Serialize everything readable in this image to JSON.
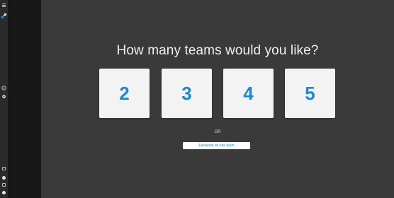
{
  "screen": {
    "question": "How many teams would you like?",
    "choices": [
      {
        "label": "2"
      },
      {
        "label": "3"
      },
      {
        "label": "4"
      },
      {
        "label": "5"
      }
    ],
    "or_label": "OR",
    "one_team_label": "Everyone on one team"
  },
  "colors": {
    "main_background": "#3a3a3a",
    "choice_background": "#f3f3f3",
    "choice_text": "#1e88d6",
    "sidebar": "#171717",
    "rail": "#2a2a2a"
  },
  "rail_icons": [
    "menu-icon",
    "app-logo-icon",
    "info-icon",
    "settings-icon",
    "panel-icon",
    "user-icon",
    "chat-icon",
    "help-icon"
  ]
}
